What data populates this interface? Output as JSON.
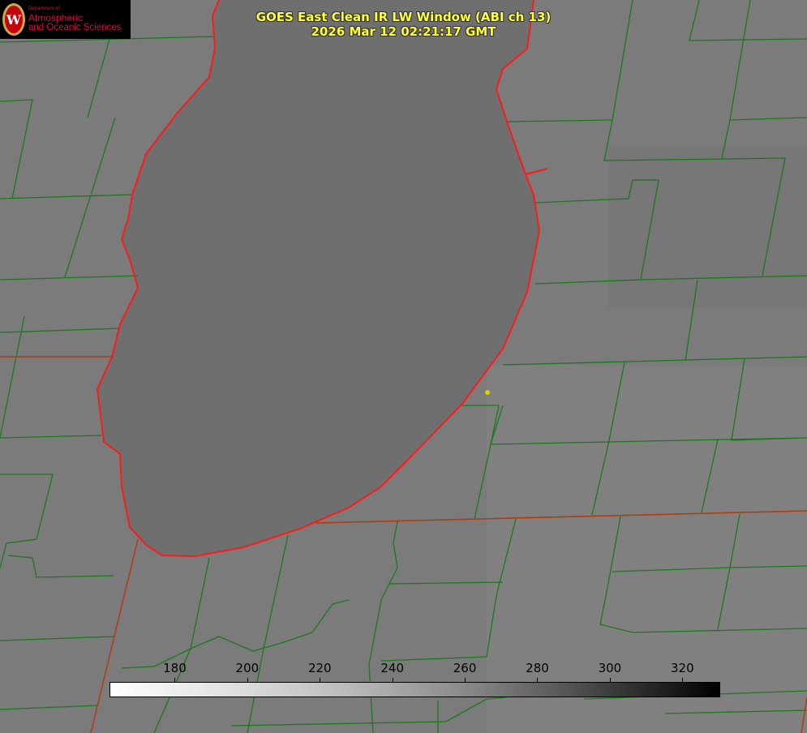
{
  "title_line1": "GOES East Clean IR LW Window (ABI ch 13)",
  "title_line2": "2026 Mar 12 02:21:17 GMT",
  "logo": {
    "dept": "Department of",
    "line1": "Atmospheric",
    "line2": "and Oceanic Sciences",
    "crest_letter": "W"
  },
  "colorbar": {
    "unit_range": [
      162,
      330
    ],
    "ticks": [
      "180",
      "200",
      "220",
      "240",
      "260",
      "280",
      "300",
      "320"
    ],
    "tick_values": [
      180,
      200,
      220,
      240,
      260,
      280,
      300,
      320
    ]
  },
  "colors": {
    "county_lines": "#1a7a1a",
    "coastline": "#ff1a1a",
    "title": "#ffff33",
    "marker": "#e0d000"
  }
}
